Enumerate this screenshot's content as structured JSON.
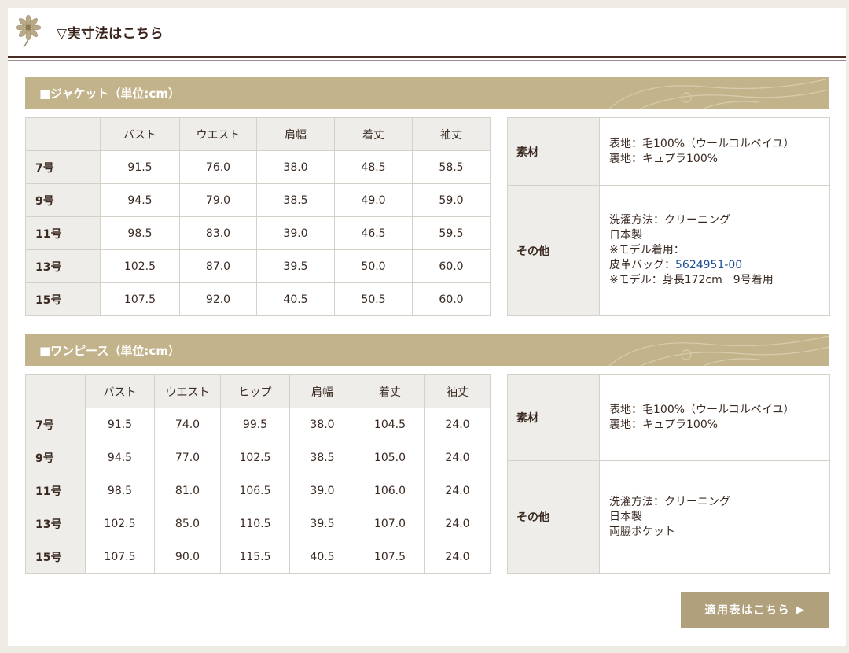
{
  "header": {
    "title": "▽実寸法はこちら"
  },
  "jacket": {
    "section_title": "■ジャケット（単位:cm）",
    "columns": [
      "バスト",
      "ウエスト",
      "肩幅",
      "着丈",
      "袖丈"
    ],
    "rows": [
      {
        "size": "7号",
        "values": [
          "91.5",
          "76.0",
          "38.0",
          "48.5",
          "58.5"
        ]
      },
      {
        "size": "9号",
        "values": [
          "94.5",
          "79.0",
          "38.5",
          "49.0",
          "59.0"
        ]
      },
      {
        "size": "11号",
        "values": [
          "98.5",
          "83.0",
          "39.0",
          "46.5",
          "59.5"
        ]
      },
      {
        "size": "13号",
        "values": [
          "102.5",
          "87.0",
          "39.5",
          "50.0",
          "60.0"
        ]
      },
      {
        "size": "15号",
        "values": [
          "107.5",
          "92.0",
          "40.5",
          "50.5",
          "60.0"
        ]
      }
    ],
    "info": {
      "material_label": "素材",
      "material_lines": [
        "表地：毛100%（ウールコルベイユ）",
        "裏地：キュプラ100%"
      ],
      "other_label": "その他",
      "other_lines": [
        "洗濯方法：クリーニング",
        "日本製",
        "※モデル着用："
      ],
      "bag_prefix": "皮革バッグ：",
      "bag_link": "5624951-00",
      "model_note": "※モデル：身長172cm　9号着用"
    }
  },
  "dress": {
    "section_title": "■ワンピース（単位:cm）",
    "columns": [
      "バスト",
      "ウエスト",
      "ヒップ",
      "肩幅",
      "着丈",
      "袖丈"
    ],
    "rows": [
      {
        "size": "7号",
        "values": [
          "91.5",
          "74.0",
          "99.5",
          "38.0",
          "104.5",
          "24.0"
        ]
      },
      {
        "size": "9号",
        "values": [
          "94.5",
          "77.0",
          "102.5",
          "38.5",
          "105.0",
          "24.0"
        ]
      },
      {
        "size": "11号",
        "values": [
          "98.5",
          "81.0",
          "106.5",
          "39.0",
          "106.0",
          "24.0"
        ]
      },
      {
        "size": "13号",
        "values": [
          "102.5",
          "85.0",
          "110.5",
          "39.5",
          "107.0",
          "24.0"
        ]
      },
      {
        "size": "15号",
        "values": [
          "107.5",
          "90.0",
          "115.5",
          "40.5",
          "107.5",
          "24.0"
        ]
      }
    ],
    "info": {
      "material_label": "素材",
      "material_lines": [
        "表地：毛100%（ウールコルベイユ）",
        "裏地：キュプラ100%"
      ],
      "other_label": "その他",
      "other_lines": [
        "洗濯方法：クリーニング",
        "日本製",
        "両脇ポケット"
      ]
    }
  },
  "button": {
    "label": "適用表はこちら",
    "icon": "triangle-right-icon"
  },
  "colors": {
    "section_bar": "#c3b38b",
    "button": "#b0a07b",
    "link": "#1e4f9c",
    "header_rule": "#4a2c26"
  }
}
